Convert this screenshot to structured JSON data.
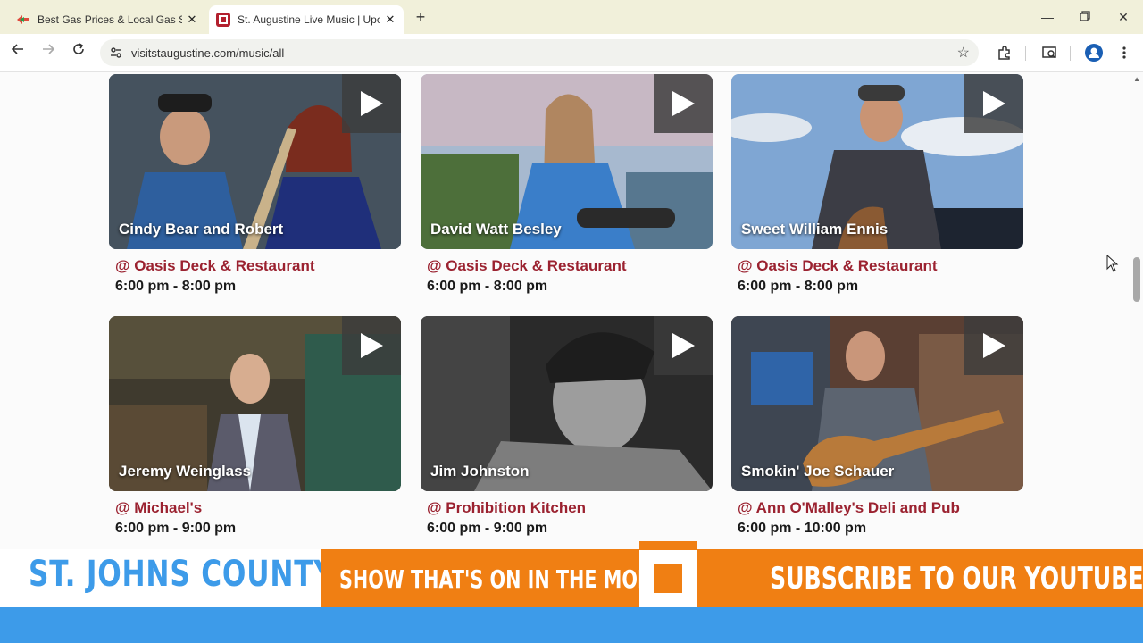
{
  "browser": {
    "tabs": [
      {
        "title": "Best Gas Prices & Local Gas Sta",
        "favicon": "gasbuddy-icon"
      },
      {
        "title": "St. Augustine Live Music | Upco",
        "favicon": "visit-st-augustine-icon",
        "active": true
      }
    ],
    "url": "visitstaugustine.com/music/all"
  },
  "events": [
    {
      "artist": "Cindy Bear and Robert",
      "venue": "@ Oasis Deck & Restaurant",
      "time": "6:00 pm - 8:00 pm"
    },
    {
      "artist": "David Watt Besley",
      "venue": "@ Oasis Deck & Restaurant",
      "time": "6:00 pm - 8:00 pm"
    },
    {
      "artist": "Sweet William Ennis",
      "venue": "@ Oasis Deck & Restaurant",
      "time": "6:00 pm - 8:00 pm"
    },
    {
      "artist": "Jeremy Weinglass",
      "venue": "@ Michael's",
      "time": "6:00 pm - 9:00 pm"
    },
    {
      "artist": "Jim Johnston",
      "venue": "@ Prohibition Kitchen",
      "time": "6:00 pm - 9:00 pm"
    },
    {
      "artist": "Smokin' Joe Schauer",
      "venue": "@ Ann O'Malley's Deli and Pub",
      "time": "6:00 pm - 10:00 pm"
    }
  ],
  "overlay": {
    "county": "ST. JOHNS COUNTY",
    "show": "SHOW THAT'S ON IN THE MORNING",
    "subscribe": "SUBSCRIBE TO OUR YOUTUBE!"
  },
  "colors": {
    "venue_text": "#9b2230",
    "banner_orange": "#f07f13",
    "banner_blue": "#3d9be9"
  }
}
